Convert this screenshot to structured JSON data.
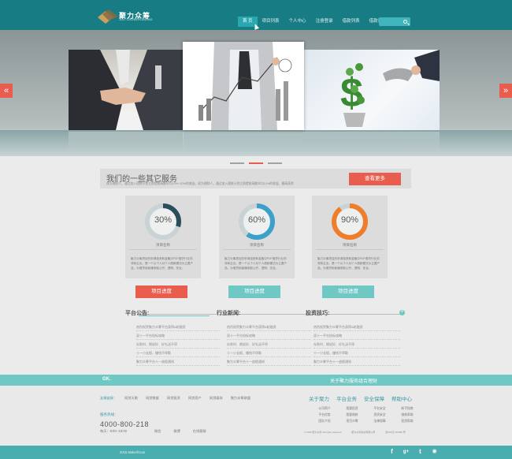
{
  "header": {
    "logo_text": "聚力众筹",
    "logo_sub": "JULI CROWDFUNDING",
    "nav": [
      "首 页",
      "项目列表",
      "个人中心",
      "注册登录",
      "借款列表",
      "借款详情"
    ],
    "search_placeholder": ""
  },
  "banner": {
    "prev": "«",
    "next": "»",
    "dots": 3,
    "active_dot": 1
  },
  "services": {
    "title": "我们的一些其它服务",
    "desc": "成为理财人，通过加入理财计划立即提前高额年均10%~20%的收益。成为理财人，通过加入理财计划立即提前高额年均10%的收益。最高获得",
    "more": "查看更多",
    "cards": [
      {
        "percent": 30,
        "label": "30%",
        "name": "项目名称",
        "desc": "聚力众筹项目的申请投资和金融中P2P借贷行业的领军企业。是一个以个人对个人借款模式为主要产品，为借贷用偷赚收取公开、透明、安全。",
        "button": "项目进度",
        "color": "#2a4e5c"
      },
      {
        "percent": 60,
        "label": "60%",
        "name": "项目名称",
        "desc": "聚力众筹项目的申请投资和金融中P2P借贷行业的领军企业。是一个以个人对个人借款模式为主要产品，为借贷用偷赚收取公开、透明、安全。",
        "button": "项目进度",
        "color": "#3da0c8"
      },
      {
        "percent": 90,
        "label": "90%",
        "name": "项目名称",
        "desc": "聚力众筹项目的申请投资和金融中P2P借贷行业的领军企业。是一个以个人对个人借款模式为主要产品，为借贷用偷赚收取公开、透明、安全。",
        "button": "项目进度",
        "color": "#ef7d2a"
      }
    ]
  },
  "news": [
    {
      "title": "平台公告:",
      "items": [
        "热烈祝贺聚力众筹平台获得A轮融资",
        "双十一平台抢标攻略",
        "存款时、期说好、好礼送不停",
        "十一小长假，赚钱不停歇",
        "聚力众筹平台十一放假通知"
      ]
    },
    {
      "title": "行业新闻:",
      "items": [
        "热烈祝贺聚力众筹平台获得A轮融资",
        "双十一平台抢标攻略",
        "存款时、期说好、好礼送不停",
        "十一小长假，赚钱不停歇",
        "聚力众筹平台十一放假通知"
      ]
    },
    {
      "title": "投资技巧:",
      "items": [
        "热烈祝贺聚力众筹平台获得A轮融资",
        "双十一平台抢标攻略",
        "存款时、期说好、好礼送不停",
        "十一小长假，赚钱不停歇",
        "聚力众筹平台十一放假通知"
      ]
    }
  ],
  "news_plus": "+",
  "footer": {
    "band_logo": "GK.",
    "slogan": "关于聚力服务组合理财",
    "friend_label": "友情链接：",
    "friends": [
      "网贷天眼",
      "网贷数据",
      "网贷投资",
      "网贷资产",
      "网贷媒体",
      "聚力众筹联盟"
    ],
    "hot_label": "服务热线：",
    "phone": "4000-800-218",
    "hours": "每天：8:00--18:00",
    "social": [
      "微信",
      "微博",
      "在线客服"
    ],
    "cols": [
      {
        "title": "关于聚力",
        "items": [
          "公司简介",
          "平台优势",
          "团队介绍"
        ]
      },
      {
        "title": "平台业务",
        "items": [
          "我要投资",
          "我要借款",
          "项目众筹"
        ]
      },
      {
        "title": "安全保障",
        "items": [
          "平台安全",
          "资质安全",
          "法律保障"
        ]
      },
      {
        "title": "帮助中心",
        "items": [
          "新手指南",
          "借款帮助",
          "投资帮助"
        ]
      }
    ],
    "copy_parts": [
      "© 2015 聚力众筹 All rights reserved",
      "聚力众筹投资有限公司",
      "京ICP证 123456 号"
    ],
    "bottom_copy": "2015  Makerfocus",
    "icons": [
      "f",
      "g+",
      "t",
      "rss"
    ]
  }
}
